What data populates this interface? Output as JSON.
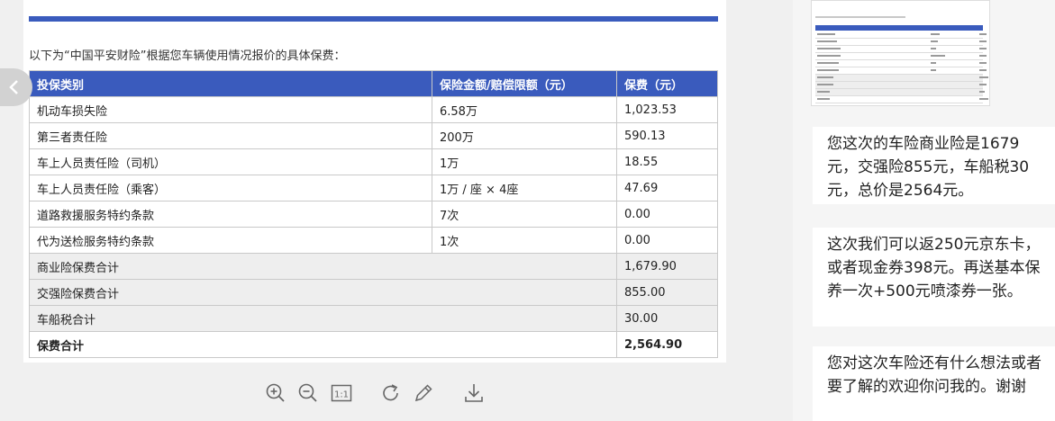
{
  "document": {
    "intro": "以下为“中国平安财险”根据您车辆使用情况报价的具体保费：",
    "headers": [
      "投保类别",
      "保险金额/赔偿限额（元）",
      "保费（元）"
    ],
    "rows": [
      [
        "机动车损失险",
        "6.58万",
        "1,023.53"
      ],
      [
        "第三者责任险",
        "200万",
        "590.13"
      ],
      [
        "车上人员责任险（司机）",
        "1万",
        "18.55"
      ],
      [
        "车上人员责任险（乘客）",
        "1万 / 座 × 4座",
        "47.69"
      ],
      [
        "道路救援服务特约条款",
        "7次",
        "0.00"
      ],
      [
        "代为送检服务特约条款",
        "1次",
        "0.00"
      ]
    ],
    "summary": [
      [
        "商业险保费合计",
        "1,679.90"
      ],
      [
        "交强险保费合计",
        "855.00"
      ],
      [
        "车船税合计",
        "30.00"
      ]
    ],
    "total": [
      "保费合计",
      "2,564.90"
    ]
  },
  "toolbar": {
    "zoom_in": "zoom-in-icon",
    "zoom_out": "zoom-out-icon",
    "actual_size_label": "1:1",
    "rotate": "rotate-icon",
    "edit": "pencil-icon",
    "download": "download-icon"
  },
  "chat": {
    "messages": [
      "您这次的车险商业险是1679元，交强险855元，车船税30元，总价是2564元。",
      "这次我们可以返250元京东卡，或者现金券398元。再送基本保养一次+500元喷漆券一张。",
      "您对这次车险还有什么想法或者要了解的欢迎你问我的。谢谢"
    ]
  },
  "colors": {
    "header_blue": "#3a5bbd",
    "summary_gray": "#eeeeee",
    "background": "#f0f0f0"
  }
}
